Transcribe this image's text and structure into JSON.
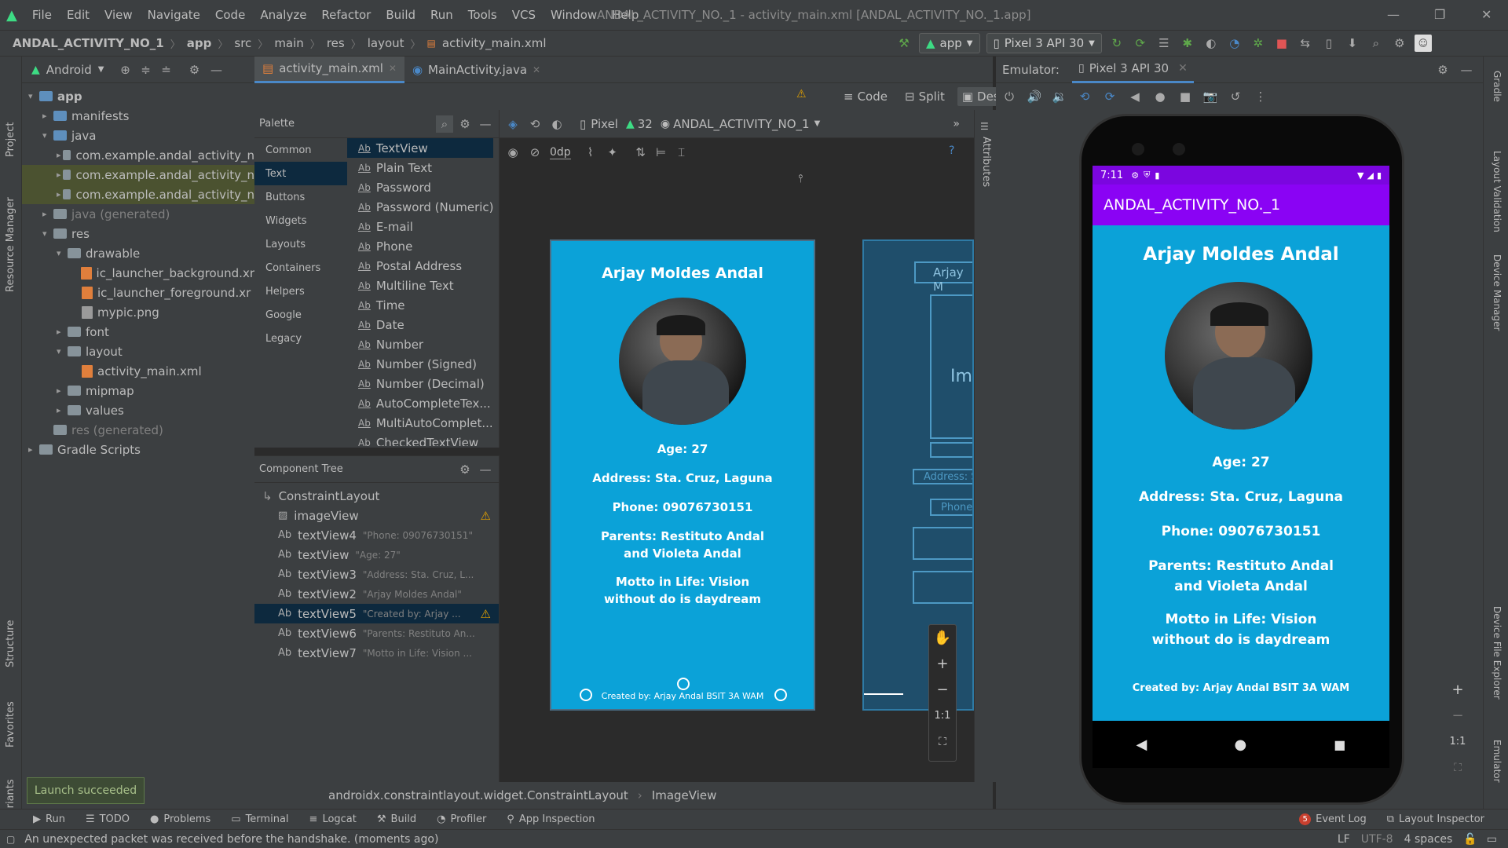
{
  "menu": [
    "File",
    "Edit",
    "View",
    "Navigate",
    "Code",
    "Analyze",
    "Refactor",
    "Build",
    "Run",
    "Tools",
    "VCS",
    "Window",
    "Help"
  ],
  "window_title": "ANDAL_ACTIVITY_NO._1 - activity_main.xml [ANDAL_ACTIVITY_NO._1.app]",
  "breadcrumbs": [
    "ANDAL_ACTIVITY_NO_1",
    "app",
    "src",
    "main",
    "res",
    "layout",
    "activity_main.xml"
  ],
  "toolbar": {
    "run_config": "app",
    "device": "Pixel 3 API 30"
  },
  "left_tools": {
    "project": "Project",
    "resource_manager": "Resource Manager",
    "structure": "Structure",
    "favorites": "Favorites",
    "build_variants": "Build Variants"
  },
  "project": {
    "view_selector": "Android",
    "tree": [
      {
        "label": "app",
        "indent": 0,
        "type": "folder-blue",
        "arrow": "▾",
        "bold": true
      },
      {
        "label": "manifests",
        "indent": 1,
        "type": "folder-blue",
        "arrow": "▸"
      },
      {
        "label": "java",
        "indent": 1,
        "type": "folder-blue",
        "arrow": "▾"
      },
      {
        "label": "com.example.andal_activity_n",
        "indent": 2,
        "type": "folder",
        "arrow": "▸"
      },
      {
        "label": "com.example.andal_activity_n",
        "indent": 2,
        "type": "folder",
        "arrow": "▸",
        "highlight": true
      },
      {
        "label": "com.example.andal_activity_n",
        "indent": 2,
        "type": "folder",
        "arrow": "▸",
        "highlight": true
      },
      {
        "label": "java (generated)",
        "indent": 1,
        "type": "folder",
        "arrow": "▸",
        "muted": true
      },
      {
        "label": "res",
        "indent": 1,
        "type": "folder",
        "arrow": "▾"
      },
      {
        "label": "drawable",
        "indent": 2,
        "type": "folder",
        "arrow": "▾"
      },
      {
        "label": "ic_launcher_background.xr",
        "indent": 3,
        "type": "xml",
        "arrow": ""
      },
      {
        "label": "ic_launcher_foreground.xr",
        "indent": 3,
        "type": "xml",
        "arrow": ""
      },
      {
        "label": "mypic.png",
        "indent": 3,
        "type": "img",
        "arrow": ""
      },
      {
        "label": "font",
        "indent": 2,
        "type": "folder",
        "arrow": "▸"
      },
      {
        "label": "layout",
        "indent": 2,
        "type": "folder",
        "arrow": "▾"
      },
      {
        "label": "activity_main.xml",
        "indent": 3,
        "type": "xml",
        "arrow": ""
      },
      {
        "label": "mipmap",
        "indent": 2,
        "type": "folder",
        "arrow": "▸"
      },
      {
        "label": "values",
        "indent": 2,
        "type": "folder",
        "arrow": "▸"
      },
      {
        "label": "res (generated)",
        "indent": 1,
        "type": "folder",
        "arrow": "",
        "muted": true
      },
      {
        "label": "Gradle Scripts",
        "indent": 0,
        "type": "gradle",
        "arrow": "▸"
      }
    ]
  },
  "editor_tabs": [
    {
      "label": "activity_main.xml",
      "active": true
    },
    {
      "label": "MainActivity.java",
      "active": false
    }
  ],
  "view_modes": [
    "Code",
    "Split",
    "Design"
  ],
  "palette": {
    "title": "Palette",
    "categories": [
      "Common",
      "Text",
      "Buttons",
      "Widgets",
      "Layouts",
      "Containers",
      "Helpers",
      "Google",
      "Legacy"
    ],
    "selected_category": "Text",
    "items": [
      "TextView",
      "Plain Text",
      "Password",
      "Password (Numeric)",
      "E-mail",
      "Phone",
      "Postal Address",
      "Multiline Text",
      "Time",
      "Date",
      "Number",
      "Number (Signed)",
      "Number (Decimal)",
      "AutoCompleteTex...",
      "MultiAutoComplet...",
      "CheckedTextView"
    ]
  },
  "component_tree": {
    "title": "Component Tree",
    "root": "ConstraintLayout",
    "items": [
      {
        "id": "imageView",
        "hint": "",
        "warn": true,
        "icon": "image"
      },
      {
        "id": "textView4",
        "hint": "\"Phone: 09076730151\"",
        "warn": false,
        "icon": "Ab"
      },
      {
        "id": "textView",
        "hint": "\"Age: 27\"",
        "warn": false,
        "icon": "Ab"
      },
      {
        "id": "textView3",
        "hint": "\"Address: Sta. Cruz, L...",
        "warn": false,
        "icon": "Ab"
      },
      {
        "id": "textView2",
        "hint": "\"Arjay Moldes Andal\"",
        "warn": false,
        "icon": "Ab"
      },
      {
        "id": "textView5",
        "hint": "\"Created by: Arjay ...",
        "warn": true,
        "icon": "Ab",
        "selected": true
      },
      {
        "id": "textView6",
        "hint": "\"Parents: Restituto An...",
        "warn": false,
        "icon": "Ab"
      },
      {
        "id": "textView7",
        "hint": "\"Motto in Life: Vision ...",
        "warn": false,
        "icon": "Ab"
      }
    ]
  },
  "design_toolbar": {
    "device": "Pixel",
    "api": "32",
    "theme": "ANDAL_ACTIVITY_NO_1",
    "margin": "0dp"
  },
  "layout_preview": {
    "name": "Arjay Moldes Andal",
    "age": "Age: 27",
    "address": "Address: Sta. Cruz, Laguna",
    "phone": "Phone: 09076730151",
    "parents_line1": "Parents: Restituto Andal",
    "parents_line2": "and Violeta Andal",
    "motto_line1": "Motto in Life: Vision",
    "motto_line2": "without do is daydream",
    "created": "Created by: Arjay Andal BSIT 3A WAM"
  },
  "blueprint_labels": {
    "name": "Arjay M",
    "image": "Ima",
    "address": "Address: S",
    "phone": "Phone"
  },
  "attributes_label": "Attributes",
  "emulator": {
    "label": "Emulator:",
    "device_tab": "Pixel 3 API 30"
  },
  "phone_screen": {
    "time": "7:11",
    "app_title": "ANDAL_ACTIVITY_NO._1",
    "name": "Arjay Moldes Andal",
    "age": "Age: 27",
    "address": "Address: Sta. Cruz, Laguna",
    "phone": "Phone: 09076730151",
    "parents_line1": "Parents: Restituto Andal",
    "parents_line2": "and Violeta Andal",
    "motto_line1": "Motto in Life: Vision",
    "motto_line2": "without do is daydream",
    "created": "Created by: Arjay Andal BSIT 3A WAM"
  },
  "right_tools": {
    "gradle": "Gradle",
    "layout_validation": "Layout Validation",
    "device_manager": "Device Manager",
    "device_file_explorer": "Device File Explorer",
    "emulator": "Emulator"
  },
  "layout_crumbs": [
    "androidx.constraintlayout.widget.ConstraintLayout",
    "ImageView"
  ],
  "bottom_tools": [
    "Run",
    "TODO",
    "Problems",
    "Terminal",
    "Logcat",
    "Build",
    "Profiler",
    "App Inspection"
  ],
  "bottom_right_tools": [
    {
      "label": "Event Log",
      "badge": "5"
    },
    {
      "label": "Layout Inspector",
      "badge": ""
    }
  ],
  "toast": "Launch succeeded",
  "status": {
    "message": "An unexpected packet was received before the handshake. (moments ago)",
    "line_sep": "LF",
    "encoding": "UTF-8",
    "indent": "4 spaces"
  },
  "zoom": {
    "fit": "1:1"
  },
  "colors": {
    "accent_purple": "#8a03f4",
    "status_purple": "#7b06df",
    "screen_blue": "#0ba2d8",
    "tab_underline": "#4a88c7"
  }
}
